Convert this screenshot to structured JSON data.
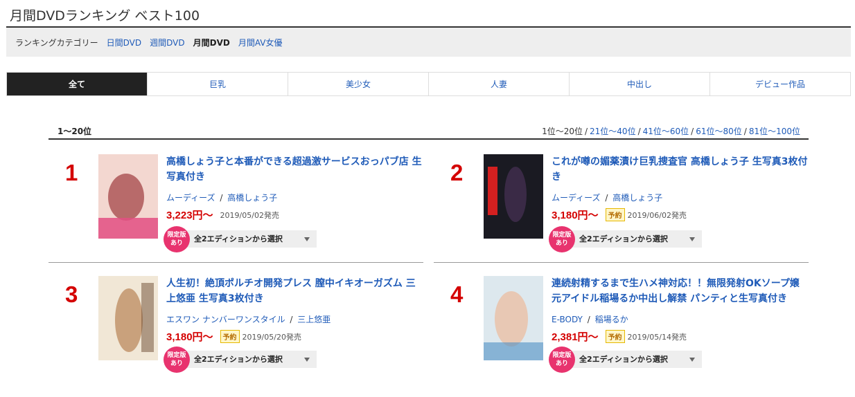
{
  "page": {
    "title": "月間DVDランキング ベスト100"
  },
  "categories": {
    "label": "ランキングカテゴリー",
    "items": [
      {
        "label": "日間DVD",
        "current": false
      },
      {
        "label": "週間DVD",
        "current": false
      },
      {
        "label": "月間DVD",
        "current": true
      },
      {
        "label": "月間AV女優",
        "current": false
      }
    ]
  },
  "genres": [
    {
      "label": "全て",
      "active": true
    },
    {
      "label": "巨乳",
      "active": false
    },
    {
      "label": "美少女",
      "active": false
    },
    {
      "label": "人妻",
      "active": false
    },
    {
      "label": "中出し",
      "active": false
    },
    {
      "label": "デビュー作品",
      "active": false
    }
  ],
  "range": {
    "current": "1〜20位",
    "nav": [
      "1位〜20位",
      "21位〜40位",
      "41位〜60位",
      "61位〜80位",
      "81位〜100位"
    ],
    "separator": "/"
  },
  "items": [
    {
      "rank": "1",
      "title": "高橋しょう子と本番ができる超過激サービスおっパブ店 生写真付き",
      "maker": "ムーディーズ",
      "actress": "高橋しょう子",
      "meta_sep": "/",
      "price": "3,223円〜",
      "yoyaku": "",
      "release": "2019/05/02発売",
      "badge": "限定版あり",
      "edition": "全2エディションから選択",
      "cover_colors": [
        "#f3d7d0",
        "#b86a6a",
        "#e24f83"
      ]
    },
    {
      "rank": "2",
      "title": "これが噂の媚薬漬け巨乳捜査官 高橋しょう子 生写真3枚付き",
      "maker": "ムーディーズ",
      "actress": "高橋しょう子",
      "meta_sep": "/",
      "price": "3,180円〜",
      "yoyaku": "予約",
      "release": "2019/06/02発売",
      "badge": "限定版あり",
      "edition": "全2エディションから選択",
      "cover_colors": [
        "#1a1a22",
        "#3a2a46",
        "#d42020"
      ]
    },
    {
      "rank": "3",
      "title": "人生初！絶頂ポルチオ開発プレス 膣中イキオーガズム 三上悠亜 生写真3枚付き",
      "maker": "エスワン ナンバーワンスタイル",
      "actress": "三上悠亜",
      "meta_sep": "/",
      "price": "3,180円〜",
      "yoyaku": "予約",
      "release": "2019/05/20発売",
      "badge": "限定版あり",
      "edition": "全2エディションから選択",
      "cover_colors": [
        "#f1e7d6",
        "#c9a17c",
        "#6b4a30"
      ]
    },
    {
      "rank": "4",
      "title": "連続射精するまで生ハメ神対応！！無限発射OKソープ嬢 元アイドル稲場るか中出し解禁 パンティと生写真付き",
      "maker": "E-BODY",
      "actress": "稲場るか",
      "meta_sep": "/",
      "price": "2,381円〜",
      "yoyaku": "予約",
      "release": "2019/05/14発売",
      "badge": "限定版あり",
      "edition": "全2エディションから選択",
      "cover_colors": [
        "#dde8ee",
        "#e8c8b4",
        "#4f8fc4"
      ]
    }
  ]
}
